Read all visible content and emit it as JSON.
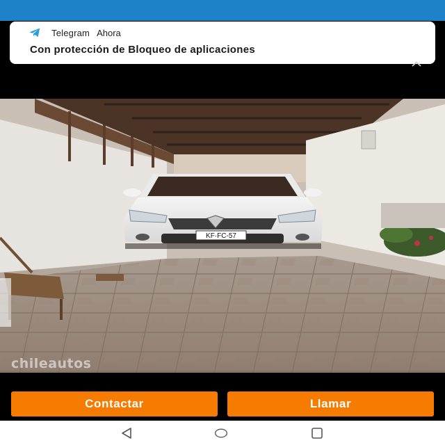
{
  "notification": {
    "app_name": "Telegram",
    "time": "Ahora",
    "text": "Con protección de Bloqueo de aplicaciones",
    "app_icon": "telegram-icon"
  },
  "photo": {
    "watermark": "chileautos",
    "license_plate": "KF·FC-57"
  },
  "actions": {
    "contact_label": "Contactar",
    "call_label": "Llamar"
  },
  "navigation": {
    "back_icon": "back-triangle-icon",
    "home_icon": "home-circle-icon",
    "recents_icon": "recents-square-icon"
  },
  "colors": {
    "status_bar": "#1e82c8",
    "accent_button": "#f57c00",
    "telegram_blue": "#2a9fd8"
  }
}
